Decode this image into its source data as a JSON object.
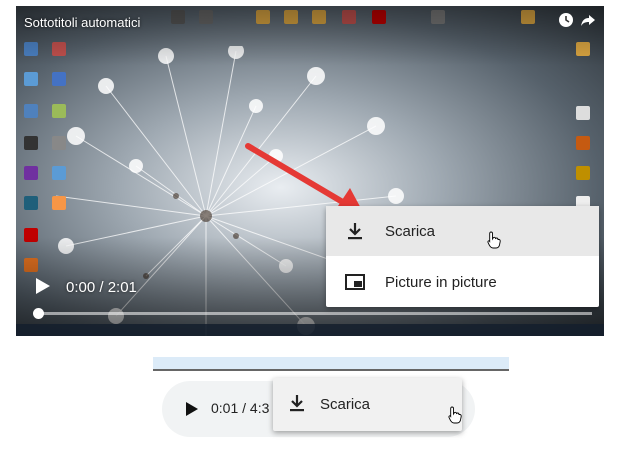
{
  "video": {
    "title": "Sottotitoli automatici",
    "time": "0:00 / 2:01",
    "progress": 0.0,
    "icons": [
      "clock-icon",
      "share-icon",
      "play-icon"
    ]
  },
  "context_menu": {
    "items": [
      {
        "label": "Scarica",
        "icon": "download-icon",
        "highlighted": true
      },
      {
        "label": "Picture in picture",
        "icon": "picture-in-picture-icon",
        "highlighted": false
      }
    ]
  },
  "audio_player": {
    "time": "0:01 / 4:3",
    "menu_item": {
      "label": "Scarica",
      "icon": "download-icon"
    }
  },
  "colors": {
    "arrow": "#e53935",
    "menu_bg": "#ffffff",
    "menu_highlight": "#e8e8e8",
    "audio_bg": "#f1f3f4",
    "strip": "#dcebf8"
  }
}
